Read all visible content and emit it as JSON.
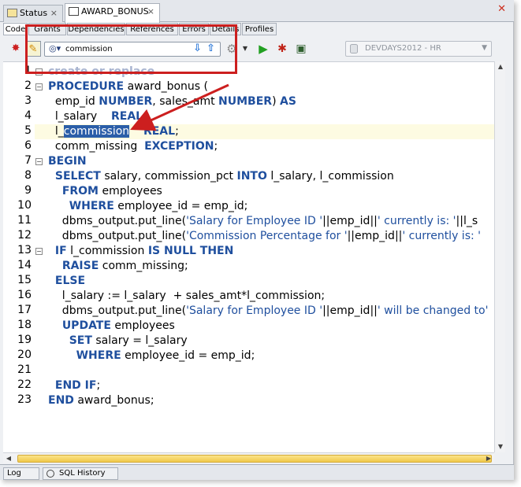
{
  "doc_tabs": {
    "status_label": "Status",
    "active_label": "AWARD_BONUS",
    "active_close": "×",
    "window_close": "✕"
  },
  "sub_tabs": [
    "Code",
    "Grants",
    "Dependencies",
    "References",
    "Errors",
    "Details",
    "Profiles"
  ],
  "toolbar": {
    "search_value": "commission",
    "connection": "DEVDAYS2012 - HR"
  },
  "editor": {
    "lines": [
      {
        "num": "1",
        "html": "<span class=\"kw\">create or replace</span>",
        "faded": true,
        "fold": "−"
      },
      {
        "num": "2",
        "html": "<span class=\"kw\">PROCEDURE</span> award_bonus (",
        "fold": "−"
      },
      {
        "num": "3",
        "html": "  emp_id <span class=\"kw\">NUMBER</span>, sales_amt <span class=\"kw\">NUMBER</span>) <span class=\"kw\">AS</span>"
      },
      {
        "num": "4",
        "html": "  l_salary    <span class=\"kw\">REAL</span>;"
      },
      {
        "num": "5",
        "html": "  l_<span class=\"sel\">commission</span>    <span class=\"kw\">REAL</span>;",
        "highlight": true
      },
      {
        "num": "6",
        "html": "  comm_missing  <span class=\"kw\">EXCEPTION</span>;"
      },
      {
        "num": "7",
        "html": "<span class=\"kw\">BEGIN</span>",
        "fold": "−"
      },
      {
        "num": "8",
        "html": "  <span class=\"kw\">SELECT</span> salary, commission_pct <span class=\"kw\">INTO</span> l_salary, l_commission"
      },
      {
        "num": "9",
        "html": "    <span class=\"kw\">FROM</span> employees"
      },
      {
        "num": "10",
        "html": "      <span class=\"kw\">WHERE</span> employee_id = emp_id;"
      },
      {
        "num": "11",
        "html": "    dbms_output.put_line(<span class=\"str\">'Salary for Employee ID '</span>||emp_id||<span class=\"str\">' currently is: '</span>||l_s"
      },
      {
        "num": "12",
        "html": "    dbms_output.put_line(<span class=\"str\">'Commission Percentage for '</span>||emp_id||<span class=\"str\">' currently is: '</span>"
      },
      {
        "num": "13",
        "html": "  <span class=\"kw\">IF</span> l_commission <span class=\"kw\">IS NULL THEN</span>",
        "fold": "−"
      },
      {
        "num": "14",
        "html": "    <span class=\"kw\">RAISE</span> comm_missing;"
      },
      {
        "num": "15",
        "html": "  <span class=\"kw\">ELSE</span>"
      },
      {
        "num": "16",
        "html": "    l_salary := l_salary  + sales_amt*l_commission;"
      },
      {
        "num": "17",
        "html": "    dbms_output.put_line(<span class=\"str\">'Salary for Employee ID '</span>||emp_id||<span class=\"str\">' will be changed to'</span>"
      },
      {
        "num": "18",
        "html": "    <span class=\"kw\">UPDATE</span> employees"
      },
      {
        "num": "19",
        "html": "      <span class=\"kw\">SET</span> salary = l_salary"
      },
      {
        "num": "20",
        "html": "        <span class=\"kw\">WHERE</span> employee_id = emp_id;"
      },
      {
        "num": "21",
        "html": ""
      },
      {
        "num": "22",
        "html": "  <span class=\"kw\">END IF</span>;"
      },
      {
        "num": "23",
        "html": "<span class=\"kw\">END</span> award_bonus;"
      }
    ]
  },
  "bottom_tabs": {
    "log_label": "Log",
    "history_label": "SQL History"
  },
  "colors": {
    "keyword": "#1f4f9e",
    "annotation_red": "#cc1f1f",
    "selection": "#2b5ea8"
  },
  "icons": [
    "pin-icon",
    "edit-icon",
    "binoculars-icon",
    "find-next-icon",
    "find-prev-icon",
    "gear-icon",
    "run-icon",
    "debug-icon",
    "compile-icon",
    "database-icon"
  ]
}
